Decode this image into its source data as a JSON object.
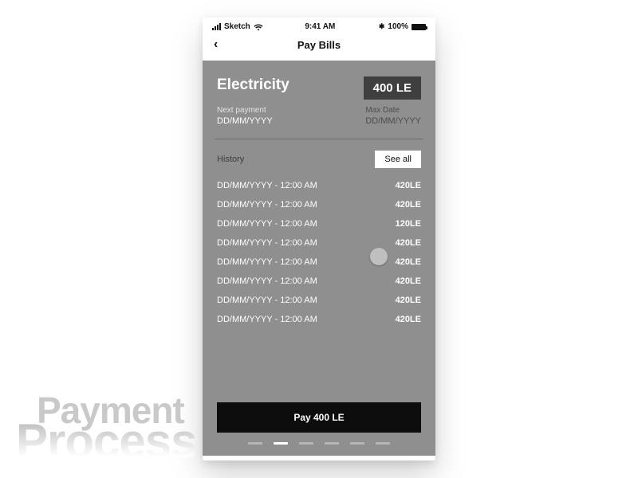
{
  "status": {
    "carrier": "Sketch",
    "time": "9:41 AM",
    "battery_pct": "100%",
    "bt_glyph": "✱"
  },
  "nav": {
    "back_glyph": "‹",
    "title": "Pay Bills"
  },
  "bill": {
    "title": "Electricity",
    "amount": "400 LE",
    "next_payment_label": "Next payment",
    "next_payment_value": "DD/MM/YYYY",
    "max_date_label": "Max Date",
    "max_date_value": "DD/MM/YYYY"
  },
  "history": {
    "label": "History",
    "see_all": "See all",
    "rows": [
      {
        "dt": "DD/MM/YYYY - 12:00 AM",
        "amt": "420LE"
      },
      {
        "dt": "DD/MM/YYYY - 12:00 AM",
        "amt": "420LE"
      },
      {
        "dt": "DD/MM/YYYY - 12:00 AM",
        "amt": "120LE"
      },
      {
        "dt": "DD/MM/YYYY - 12:00 AM",
        "amt": "420LE"
      },
      {
        "dt": "DD/MM/YYYY - 12:00 AM",
        "amt": "420LE"
      },
      {
        "dt": "DD/MM/YYYY - 12:00 AM",
        "amt": "420LE"
      },
      {
        "dt": "DD/MM/YYYY - 12:00 AM",
        "amt": "420LE"
      },
      {
        "dt": "DD/MM/YYYY - 12:00 AM",
        "amt": "420LE"
      }
    ]
  },
  "cta": {
    "pay_label": "Pay 400 LE"
  },
  "pager": {
    "count": 6,
    "active_index": 1
  },
  "wordmark": {
    "line1": "Payment",
    "line2": "Process"
  }
}
